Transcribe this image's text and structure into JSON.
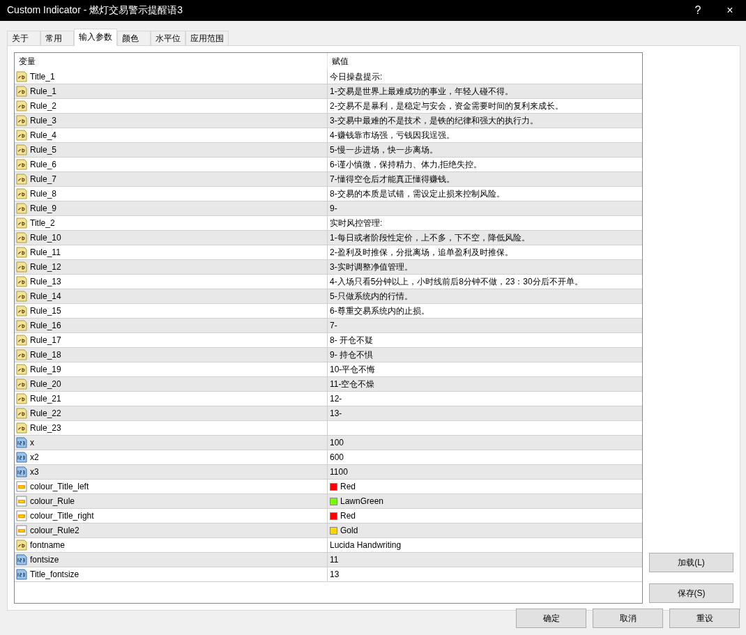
{
  "window": {
    "title": "Custom Indicator - 燃灯交易警示提醒语3",
    "help": "?",
    "close": "×"
  },
  "tabs": [
    {
      "label": "关于",
      "selected": false
    },
    {
      "label": "常用",
      "selected": false
    },
    {
      "label": "输入参数",
      "selected": true
    },
    {
      "label": "颜色",
      "selected": false
    },
    {
      "label": "水平位",
      "selected": false
    },
    {
      "label": "应用范围",
      "selected": false
    }
  ],
  "table": {
    "columns": [
      "变量",
      "赋值"
    ],
    "rows": [
      {
        "kind": "string",
        "name": "Title_1",
        "value": "今日操盘提示:"
      },
      {
        "kind": "string",
        "name": "Rule_1",
        "value": "1-交易是世界上最难成功的事业，年轻人碰不得。"
      },
      {
        "kind": "string",
        "name": "Rule_2",
        "value": "2-交易不是暴利，是稳定与安会，资金需要时间的复利来成长。"
      },
      {
        "kind": "string",
        "name": "Rule_3",
        "value": "3-交易中最难的不是技术，是铁的纪律和强大的执行力。"
      },
      {
        "kind": "string",
        "name": "Rule_4",
        "value": "4-赚钱靠市场强，亏钱因我逞强。"
      },
      {
        "kind": "string",
        "name": "Rule_5",
        "value": "5-慢一步进场，快一步离场。"
      },
      {
        "kind": "string",
        "name": "Rule_6",
        "value": "6-谨小慎微，保持精力、体力,拒绝失控。"
      },
      {
        "kind": "string",
        "name": "Rule_7",
        "value": "7-懂得空仓后才能真正懂得赚钱。"
      },
      {
        "kind": "string",
        "name": "Rule_8",
        "value": "8-交易的本质是试错，需设定止损来控制风险。"
      },
      {
        "kind": "string",
        "name": "Rule_9",
        "value": "9-"
      },
      {
        "kind": "string",
        "name": "Title_2",
        "value": "实时风控管理:"
      },
      {
        "kind": "string",
        "name": "Rule_10",
        "value": "1-每日或者阶段性定价，上不多，下不空，降低风险。"
      },
      {
        "kind": "string",
        "name": "Rule_11",
        "value": "2-盈利及时推保，分批离场，追单盈利及时推保。"
      },
      {
        "kind": "string",
        "name": "Rule_12",
        "value": "3-实时调整净值管理。"
      },
      {
        "kind": "string",
        "name": "Rule_13",
        "value": "4-入场只看5分钟以上，小时线前后8分钟不做，23：30分后不开单。"
      },
      {
        "kind": "string",
        "name": "Rule_14",
        "value": "5-只做系统内的行情。"
      },
      {
        "kind": "string",
        "name": "Rule_15",
        "value": "6-尊重交易系统内的止损。"
      },
      {
        "kind": "string",
        "name": "Rule_16",
        "value": "7-"
      },
      {
        "kind": "string",
        "name": "Rule_17",
        "value": "8- 开仓不疑"
      },
      {
        "kind": "string",
        "name": "Rule_18",
        "value": "9- 持仓不惧"
      },
      {
        "kind": "string",
        "name": "Rule_19",
        "value": "10-平仓不悔"
      },
      {
        "kind": "string",
        "name": "Rule_20",
        "value": "11-空仓不燥"
      },
      {
        "kind": "string",
        "name": "Rule_21",
        "value": "12-"
      },
      {
        "kind": "string",
        "name": "Rule_22",
        "value": "13-"
      },
      {
        "kind": "string",
        "name": "Rule_23"
      },
      {
        "kind": "number",
        "name": "x",
        "value": "100"
      },
      {
        "kind": "number",
        "name": "x2",
        "value": "600"
      },
      {
        "kind": "number",
        "name": "x3",
        "value": "1100"
      },
      {
        "kind": "color",
        "name": "colour_Title_left",
        "value": "Red",
        "color": "#ff0000"
      },
      {
        "kind": "color",
        "name": "colour_Rule",
        "value": "LawnGreen",
        "color": "#7cfc00"
      },
      {
        "kind": "color",
        "name": "colour_Title_right",
        "value": "Red",
        "color": "#ff0000"
      },
      {
        "kind": "color",
        "name": "colour_Rule2",
        "value": "Gold",
        "color": "#ffd700"
      },
      {
        "kind": "string",
        "name": "fontname",
        "value": "Lucida Handwriting"
      },
      {
        "kind": "number",
        "name": "fontsize",
        "value": "11"
      },
      {
        "kind": "number",
        "name": "Title_fontsize",
        "value": "13"
      }
    ]
  },
  "side_buttons": [
    "加载(L)",
    "保存(S)"
  ],
  "buttons": [
    "确定",
    "取消",
    "重设"
  ]
}
